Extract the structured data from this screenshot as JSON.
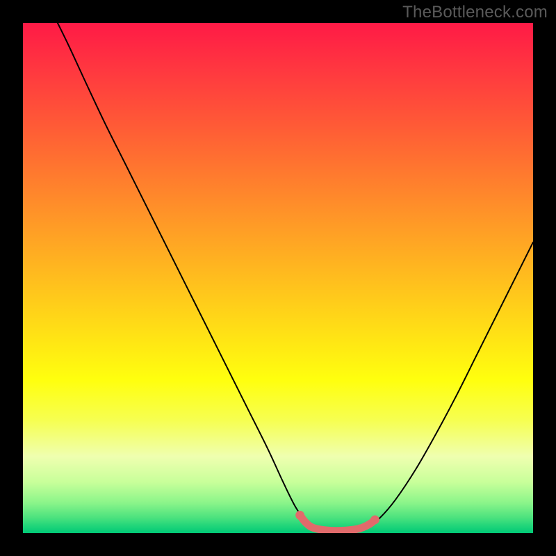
{
  "watermark": "TheBottleneck.com",
  "chart_data": {
    "type": "line",
    "title": "",
    "xlabel": "",
    "ylabel": "",
    "xlim": [
      0,
      100
    ],
    "ylim": [
      0,
      100
    ],
    "background_gradient": {
      "stops": [
        {
          "offset": 0.0,
          "color": "#ff1a46"
        },
        {
          "offset": 0.1,
          "color": "#ff3a3f"
        },
        {
          "offset": 0.2,
          "color": "#ff5a36"
        },
        {
          "offset": 0.3,
          "color": "#ff7b2e"
        },
        {
          "offset": 0.4,
          "color": "#ff9c26"
        },
        {
          "offset": 0.5,
          "color": "#ffbd1e"
        },
        {
          "offset": 0.6,
          "color": "#ffde16"
        },
        {
          "offset": 0.7,
          "color": "#ffff0e"
        },
        {
          "offset": 0.78,
          "color": "#f6ff52"
        },
        {
          "offset": 0.85,
          "color": "#efffb0"
        },
        {
          "offset": 0.9,
          "color": "#c8ff9a"
        },
        {
          "offset": 0.94,
          "color": "#8cf58a"
        },
        {
          "offset": 0.97,
          "color": "#4be27e"
        },
        {
          "offset": 0.985,
          "color": "#23d67a"
        },
        {
          "offset": 1.0,
          "color": "#00c976"
        }
      ]
    },
    "series": [
      {
        "name": "curve",
        "color": "#000000",
        "points": [
          {
            "x": 6.8,
            "y": 100.0
          },
          {
            "x": 9.0,
            "y": 95.5
          },
          {
            "x": 12.0,
            "y": 89.0
          },
          {
            "x": 16.0,
            "y": 80.5
          },
          {
            "x": 20.0,
            "y": 72.5
          },
          {
            "x": 24.0,
            "y": 64.5
          },
          {
            "x": 28.0,
            "y": 56.5
          },
          {
            "x": 32.0,
            "y": 48.5
          },
          {
            "x": 36.0,
            "y": 40.5
          },
          {
            "x": 40.0,
            "y": 32.5
          },
          {
            "x": 44.0,
            "y": 24.5
          },
          {
            "x": 48.0,
            "y": 16.5
          },
          {
            "x": 51.0,
            "y": 10.0
          },
          {
            "x": 53.5,
            "y": 5.0
          },
          {
            "x": 55.5,
            "y": 2.3
          },
          {
            "x": 57.0,
            "y": 1.2
          },
          {
            "x": 60.0,
            "y": 0.5
          },
          {
            "x": 63.0,
            "y": 0.5
          },
          {
            "x": 66.0,
            "y": 0.8
          },
          {
            "x": 68.0,
            "y": 1.5
          },
          {
            "x": 70.0,
            "y": 3.0
          },
          {
            "x": 73.0,
            "y": 6.5
          },
          {
            "x": 77.0,
            "y": 12.5
          },
          {
            "x": 81.0,
            "y": 19.5
          },
          {
            "x": 85.0,
            "y": 27.0
          },
          {
            "x": 89.0,
            "y": 35.0
          },
          {
            "x": 93.0,
            "y": 43.0
          },
          {
            "x": 97.0,
            "y": 51.0
          },
          {
            "x": 100.0,
            "y": 57.0
          }
        ]
      },
      {
        "name": "highlight-band",
        "color": "#e16a6b",
        "stroke_width": 11,
        "points": [
          {
            "x": 54.3,
            "y": 3.5
          },
          {
            "x": 55.5,
            "y": 2.0
          },
          {
            "x": 57.0,
            "y": 1.0
          },
          {
            "x": 60.0,
            "y": 0.5
          },
          {
            "x": 63.0,
            "y": 0.5
          },
          {
            "x": 66.0,
            "y": 0.9
          },
          {
            "x": 68.0,
            "y": 1.8
          },
          {
            "x": 69.0,
            "y": 2.6
          }
        ]
      }
    ]
  }
}
